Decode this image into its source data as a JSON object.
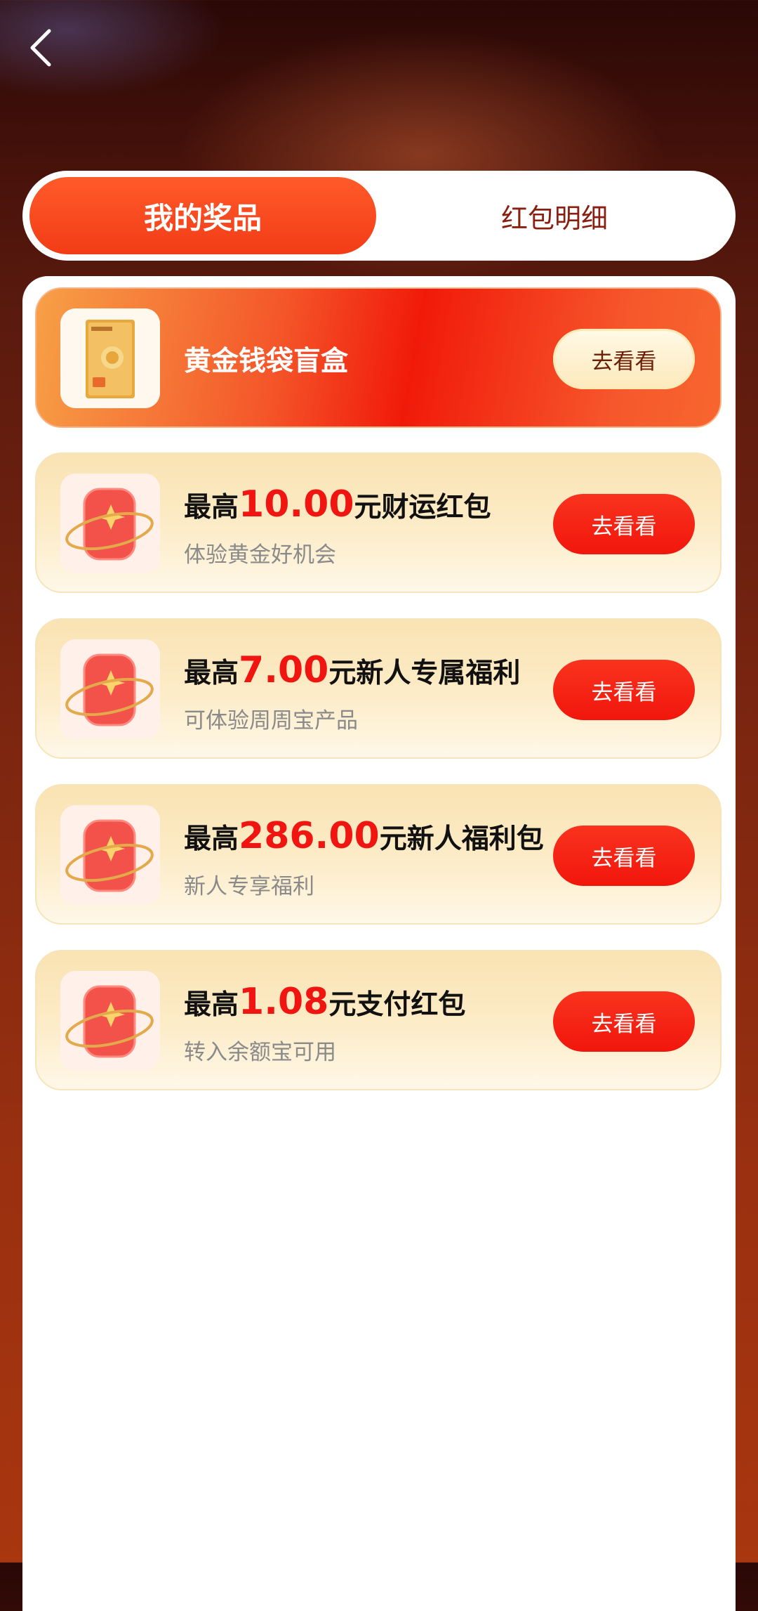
{
  "tabs": [
    {
      "label": "我的奖品",
      "active": true
    },
    {
      "label": "红包明细",
      "active": false
    }
  ],
  "gold_card": {
    "title": "黄金钱袋盲盒",
    "button": "去看看"
  },
  "rewards": [
    {
      "prefix": "最高",
      "amount": "10.00",
      "suffix": "元财运红包",
      "subtitle": "体验黄金好机会",
      "button": "去看看"
    },
    {
      "prefix": "最高",
      "amount": "7.00",
      "suffix": "元新人专属福利",
      "subtitle": "可体验周周宝产品",
      "button": "去看看"
    },
    {
      "prefix": "最高",
      "amount": "286.00",
      "suffix": "元新人福利包",
      "subtitle": "新人专享福利",
      "button": "去看看"
    },
    {
      "prefix": "最高",
      "amount": "1.08",
      "suffix": "元支付红包",
      "subtitle": "转入余额宝可用",
      "button": "去看看"
    }
  ],
  "colors": {
    "accent": "#f23c16",
    "amount": "#f01510",
    "tab_inactive_text": "#8a1f10"
  },
  "icons": {
    "back": "chevron-left-icon",
    "gold_thumb": "gold-box-image",
    "reward_thumb": "red-envelope-icon"
  }
}
